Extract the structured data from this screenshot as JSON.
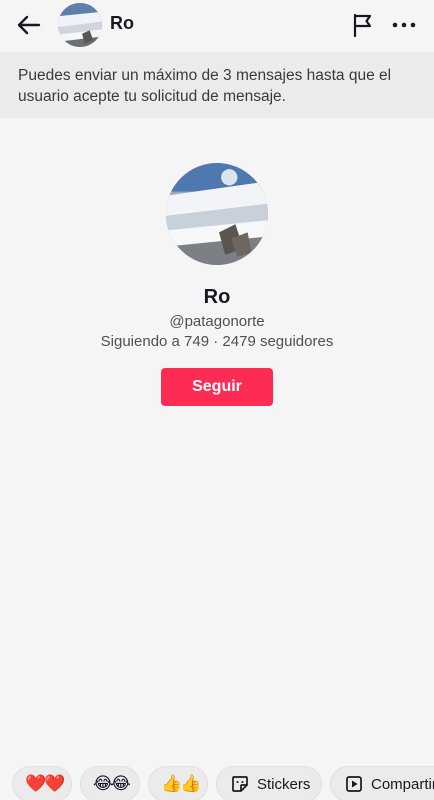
{
  "header": {
    "title": "Ro",
    "icons": {
      "back": "back-arrow-icon",
      "report": "flag-icon",
      "more": "more-dots-icon"
    }
  },
  "notice": {
    "text": "Puedes enviar un máximo de 3 mensajes hasta que el usuario acepte tu solicitud de mensaje."
  },
  "profile": {
    "name": "Ro",
    "handle": "@patagonorte",
    "stats": "Siguiendo a 749 · 2479 seguidores",
    "follow_label": "Seguir"
  },
  "quick_actions": {
    "hearts": "❤️❤️",
    "laugh": "😂😂",
    "thumbs": "👍👍",
    "stickers": "Stickers",
    "share": "Compartir"
  },
  "colors": {
    "accent": "#fe2c55",
    "background": "#f5f5f5",
    "notice_bg": "#ebebeb"
  }
}
